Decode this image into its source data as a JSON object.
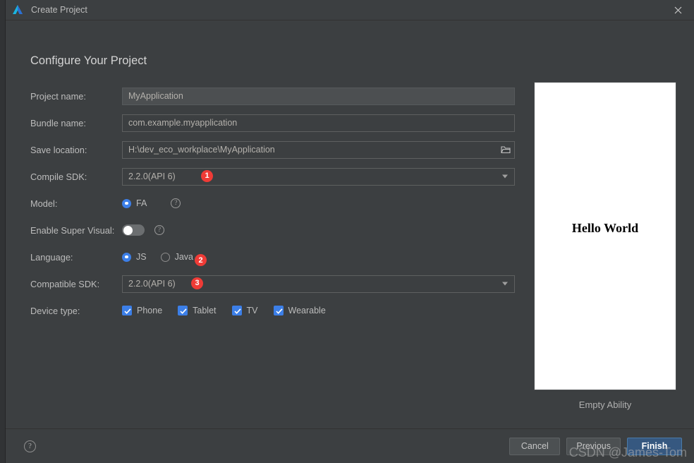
{
  "titlebar": {
    "title": "Create Project",
    "app_icon": "deveco-logo-icon",
    "close_icon": "close-icon"
  },
  "heading": "Configure Your Project",
  "form": {
    "project_name": {
      "label": "Project name:",
      "value": "MyApplication"
    },
    "bundle_name": {
      "label": "Bundle name:",
      "value": "com.example.myapplication"
    },
    "save_location": {
      "label": "Save location:",
      "value": "H:\\dev_eco_workplace\\MyApplication",
      "browse_icon": "folder-open-icon"
    },
    "compile_sdk": {
      "label": "Compile SDK:",
      "value": "2.2.0(API 6)",
      "badge": "1"
    },
    "model": {
      "label": "Model:",
      "options": [
        {
          "label": "FA",
          "selected": true
        }
      ],
      "help_icon": "question-mark-icon"
    },
    "enable_super_visual": {
      "label": "Enable Super Visual:",
      "enabled": false,
      "help_icon": "question-mark-icon"
    },
    "language": {
      "label": "Language:",
      "options": [
        {
          "label": "JS",
          "selected": true
        },
        {
          "label": "Java",
          "selected": false
        }
      ],
      "badge": "2"
    },
    "compatible_sdk": {
      "label": "Compatible SDK:",
      "value": "2.2.0(API 6)",
      "badge": "3"
    },
    "device_type": {
      "label": "Device type:",
      "options": [
        {
          "label": "Phone",
          "checked": true
        },
        {
          "label": "Tablet",
          "checked": true
        },
        {
          "label": "TV",
          "checked": true
        },
        {
          "label": "Wearable",
          "checked": true
        }
      ]
    }
  },
  "preview": {
    "screen_text": "Hello World",
    "caption": "Empty Ability"
  },
  "footer": {
    "help_icon": "question-mark-icon",
    "cancel_label": "Cancel",
    "previous_label": "Previous",
    "finish_label": "Finish"
  },
  "watermark": "CSDN @James-Tom",
  "colors": {
    "dialog_bg": "#3c3f41",
    "accent_blue": "#3c7fe8",
    "primary_button": "#365880",
    "badge_red": "#ef3b36",
    "text": "#bcbcbc"
  }
}
